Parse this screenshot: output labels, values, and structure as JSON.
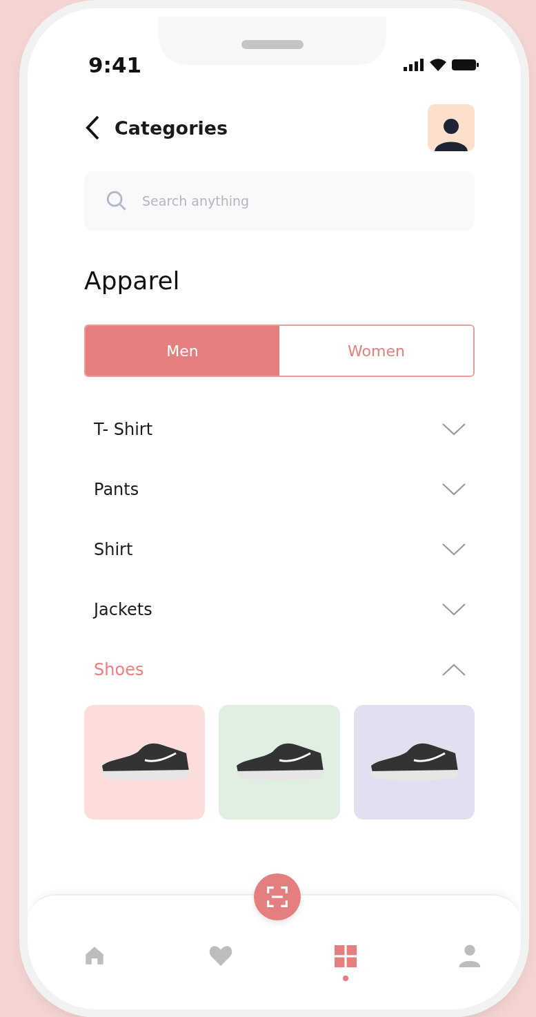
{
  "status_bar": {
    "time": "9:41"
  },
  "header": {
    "title": "Categories"
  },
  "search": {
    "placeholder": "Search anything"
  },
  "section_title": "Apparel",
  "tabs": [
    {
      "label": "Men",
      "selected": true
    },
    {
      "label": "Women",
      "selected": false
    }
  ],
  "categories": [
    {
      "label": "T- Shirt",
      "expanded": false
    },
    {
      "label": "Pants",
      "expanded": false
    },
    {
      "label": "Shirt",
      "expanded": false
    },
    {
      "label": "Jackets",
      "expanded": false
    },
    {
      "label": "Shoes",
      "expanded": true
    }
  ],
  "products": [
    {
      "color": "#fddcdc"
    },
    {
      "color": "#dff0e2"
    },
    {
      "color": "#e0e0f1"
    }
  ],
  "bottom_nav": [
    {
      "kind": "home",
      "selected": false
    },
    {
      "kind": "heart",
      "selected": false
    },
    {
      "kind": "grid",
      "selected": true
    },
    {
      "kind": "person",
      "selected": false
    }
  ]
}
